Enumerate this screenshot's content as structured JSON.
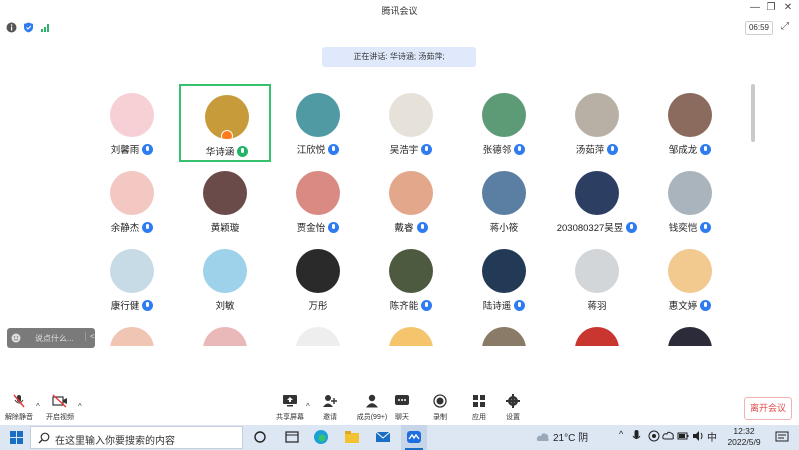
{
  "window": {
    "title": "腾讯会议",
    "minimize": "—",
    "restore": "❐",
    "close": "✕"
  },
  "info_bar": {
    "time": "06:59",
    "expand": "⤢"
  },
  "speaking_banner": "正在讲话: 华诗涵; 汤茹萍;",
  "participants": [
    {
      "name": "刘馨雨",
      "mic": "on",
      "color": "#f6d0d4"
    },
    {
      "name": "华诗涵",
      "mic": "talking",
      "color": "#c79a3a",
      "selected": true
    },
    {
      "name": "江欣悦",
      "mic": "on",
      "color": "#4f9aa3"
    },
    {
      "name": "吴浩宇",
      "mic": "on",
      "color": "#e6e2da"
    },
    {
      "name": "张德邻",
      "mic": "on",
      "color": "#5d9b76"
    },
    {
      "name": "汤茹萍",
      "mic": "talking-blue",
      "color": "#b8b0a5"
    },
    {
      "name": "邹成龙",
      "mic": "on",
      "color": "#8a6b5d"
    },
    {
      "name": "余静杰",
      "mic": "on",
      "color": "#f3c7c2"
    },
    {
      "name": "黄颖璇",
      "mic": "off",
      "color": "#6b4a4a"
    },
    {
      "name": "贾金怡",
      "mic": "on",
      "color": "#d98a82"
    },
    {
      "name": "戴睿",
      "mic": "on",
      "color": "#e3a88c"
    },
    {
      "name": "蒋小筱",
      "mic": "off",
      "color": "#5b7fa3"
    },
    {
      "name": "203080327吴昱",
      "mic": "on",
      "color": "#2c3f63"
    },
    {
      "name": "钱奕恺",
      "mic": "on",
      "color": "#a9b4bd"
    },
    {
      "name": "康行健",
      "mic": "on",
      "color": "#c7dbe6"
    },
    {
      "name": "刘敏",
      "mic": "off",
      "color": "#9ed1ea"
    },
    {
      "name": "万彤",
      "mic": "off",
      "color": "#2a2a2a"
    },
    {
      "name": "陈齐能",
      "mic": "on",
      "color": "#4d5a3f"
    },
    {
      "name": "陆诗遥",
      "mic": "on",
      "color": "#223a55"
    },
    {
      "name": "蒋羽",
      "mic": "off",
      "color": "#d3d6d9"
    },
    {
      "name": "惠文婷",
      "mic": "on",
      "color": "#f2c98e"
    },
    {
      "name": "",
      "mic": "none",
      "color": "#f1c5b3"
    },
    {
      "name": "",
      "mic": "none",
      "color": "#e9b8b8"
    },
    {
      "name": "",
      "mic": "none",
      "color": "#eeeeee"
    },
    {
      "name": "",
      "mic": "none",
      "color": "#f4c56d"
    },
    {
      "name": "",
      "mic": "none",
      "color": "#8a7a68"
    },
    {
      "name": "",
      "mic": "none",
      "color": "#c9352f"
    },
    {
      "name": "",
      "mic": "none",
      "color": "#2b2b3a"
    }
  ],
  "chat": {
    "placeholder": "说点什么...",
    "collapse": "<"
  },
  "toolbar": {
    "unmute": "解除静音",
    "start_video": "开启视频",
    "share_screen": "共享屏幕",
    "invite": "邀请",
    "members": "成员(99+)",
    "chat": "聊天",
    "record": "录制",
    "apps": "应用",
    "settings": "设置",
    "leave": "离开会议"
  },
  "taskbar": {
    "search_placeholder": "在这里输入你要搜索的内容",
    "weather": "21°C 阴",
    "ime": "中",
    "time": "12:32",
    "date": "2022/5/9"
  }
}
